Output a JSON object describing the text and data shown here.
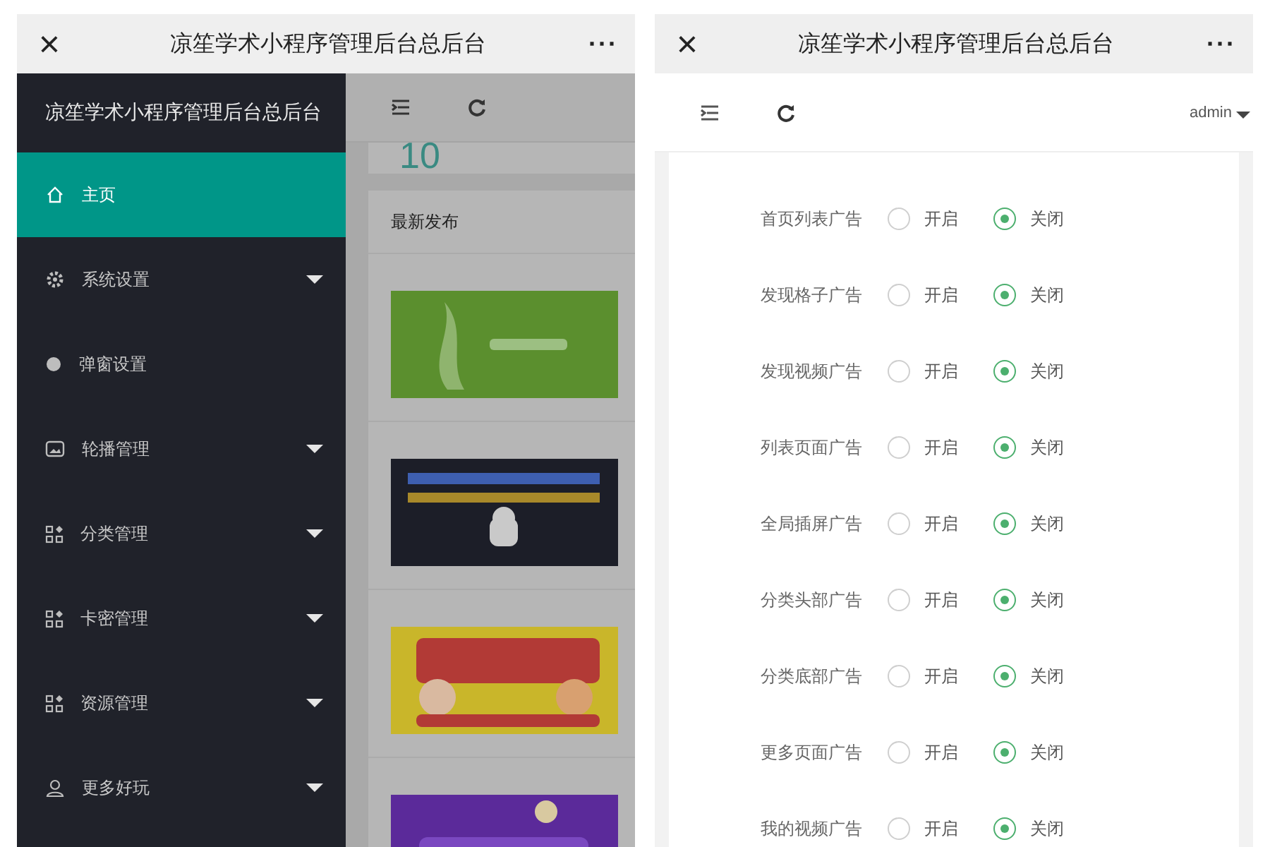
{
  "left_screen": {
    "title_bar": {
      "close": "×",
      "title": "凉笙学术小程序管理后台总后台",
      "more": "···"
    },
    "sidebar": {
      "brand": "凉笙学术小程序管理后台总后台",
      "items": [
        {
          "label": "主页",
          "selected": true,
          "expandable": false
        },
        {
          "label": "系统设置",
          "selected": false,
          "expandable": true
        },
        {
          "label": "弹窗设置",
          "selected": false,
          "expandable": false
        },
        {
          "label": "轮播管理",
          "selected": false,
          "expandable": true
        },
        {
          "label": "分类管理",
          "selected": false,
          "expandable": true
        },
        {
          "label": "卡密管理",
          "selected": false,
          "expandable": true
        },
        {
          "label": "资源管理",
          "selected": false,
          "expandable": true
        },
        {
          "label": "更多好玩",
          "selected": false,
          "expandable": true
        }
      ]
    },
    "stat_value": "10",
    "latest": {
      "heading": "最新发布"
    }
  },
  "right_screen": {
    "title_bar": {
      "close": "×",
      "title": "凉笙学术小程序管理后台总后台",
      "more": "···"
    },
    "user": "admin",
    "ad_settings": [
      {
        "label": "首页列表广告",
        "options": [
          {
            "label": "开启",
            "selected": false
          },
          {
            "label": "关闭",
            "selected": true
          }
        ]
      },
      {
        "label": "发现格子广告",
        "options": [
          {
            "label": "开启",
            "selected": false
          },
          {
            "label": "关闭",
            "selected": true
          }
        ]
      },
      {
        "label": "发现视频广告",
        "options": [
          {
            "label": "开启",
            "selected": false
          },
          {
            "label": "关闭",
            "selected": true
          }
        ]
      },
      {
        "label": "列表页面广告",
        "options": [
          {
            "label": "开启",
            "selected": false
          },
          {
            "label": "关闭",
            "selected": true
          }
        ]
      },
      {
        "label": "全局插屏广告",
        "options": [
          {
            "label": "开启",
            "selected": false
          },
          {
            "label": "关闭",
            "selected": true
          }
        ]
      },
      {
        "label": "分类头部广告",
        "options": [
          {
            "label": "开启",
            "selected": false
          },
          {
            "label": "关闭",
            "selected": true
          }
        ]
      },
      {
        "label": "分类底部广告",
        "options": [
          {
            "label": "开启",
            "selected": false
          },
          {
            "label": "关闭",
            "selected": true
          }
        ]
      },
      {
        "label": "更多页面广告",
        "options": [
          {
            "label": "开启",
            "selected": false
          },
          {
            "label": "关闭",
            "selected": true
          }
        ]
      },
      {
        "label": "我的视频广告",
        "options": [
          {
            "label": "开启",
            "selected": false
          },
          {
            "label": "关闭",
            "selected": true
          }
        ]
      }
    ]
  }
}
